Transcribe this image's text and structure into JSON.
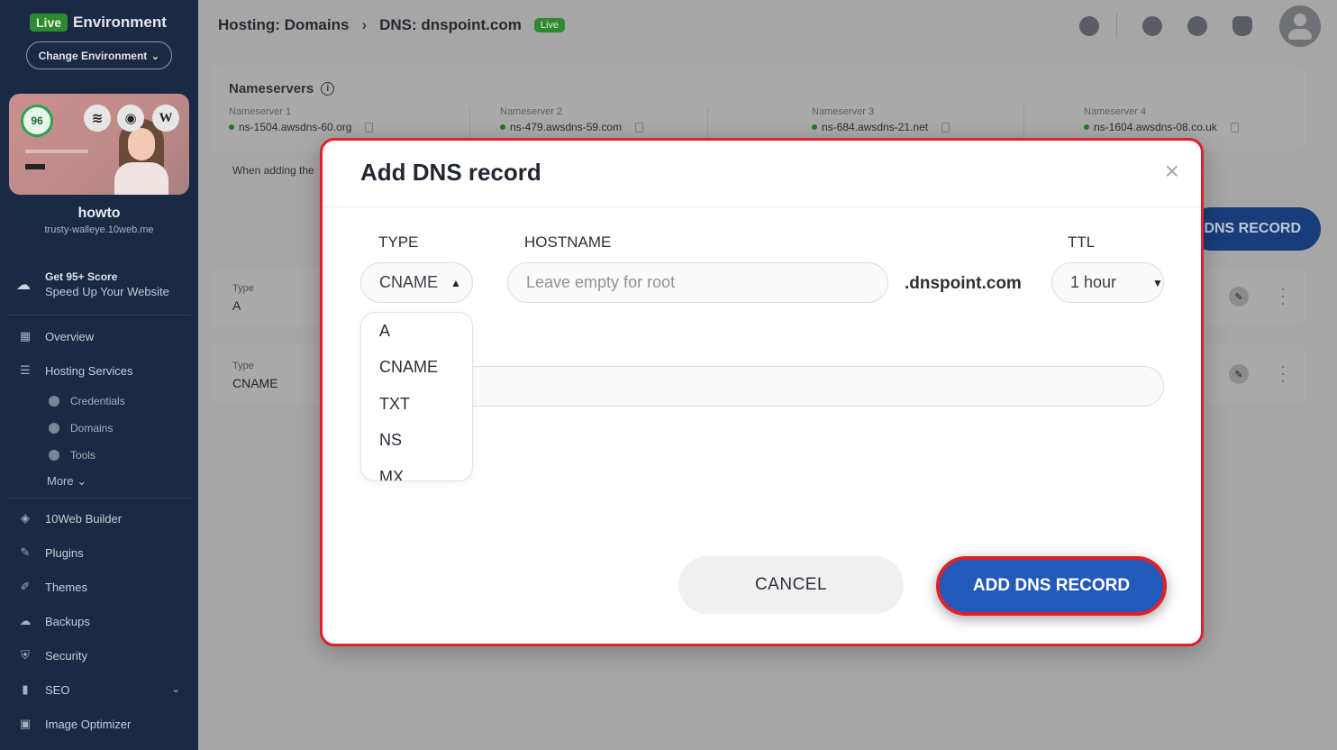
{
  "sidebar": {
    "env_badge": "Live",
    "env_title": "Environment",
    "change_env": "Change Environment",
    "score": "96",
    "card_icons": [
      "layers-icon",
      "eye-icon",
      "wordpress-icon"
    ],
    "wp_letter": "W",
    "site_name": "howto",
    "site_url": "trusty-walleye.10web.me",
    "promo_line1": "Get 95+ Score",
    "promo_line2": "Speed Up Your Website",
    "nav": {
      "overview": "Overview",
      "hosting_services": "Hosting Services",
      "credentials": "Credentials",
      "domains": "Domains",
      "tools": "Tools",
      "more": "More",
      "builder": "10Web Builder",
      "plugins": "Plugins",
      "themes": "Themes",
      "backups": "Backups",
      "security": "Security",
      "seo": "SEO",
      "image_optimizer": "Image Optimizer"
    }
  },
  "header": {
    "crumb1": "Hosting: Domains",
    "crumb2": "DNS: dnspoint.com",
    "badge": "Live"
  },
  "nameservers": {
    "title": "Nameservers",
    "items": [
      {
        "label": "Nameserver 1",
        "value": "ns-1504.awsdns-60.org"
      },
      {
        "label": "Nameserver 2",
        "value": "ns-479.awsdns-59.com"
      },
      {
        "label": "Nameserver 3",
        "value": "ns-684.awsdns-21.net"
      },
      {
        "label": "Nameserver 4",
        "value": "ns-1604.awsdns-08.co.uk"
      }
    ],
    "hint": "When adding the"
  },
  "background": {
    "add_button": "DNS RECORD",
    "records": [
      {
        "type_label": "Type",
        "type_value": "A"
      },
      {
        "type_label": "Type",
        "type_value": "CNAME"
      }
    ]
  },
  "modal": {
    "title": "Add DNS record",
    "type_label": "TYPE",
    "hostname_label": "HOSTNAME",
    "ttl_label": "TTL",
    "type_value": "CNAME",
    "hostname_placeholder": "Leave empty for root",
    "domain_suffix": ".dnspoint.com",
    "ttl_value": "1 hour",
    "type_options": [
      "A",
      "CNAME",
      "TXT",
      "NS",
      "MX"
    ],
    "cancel": "CANCEL",
    "submit": "ADD DNS RECORD"
  },
  "colors": {
    "sidebar_bg": "#1b2a44",
    "accent_blue": "#2359b8",
    "highlight_red": "#e0202a",
    "live_green": "#2e8a2f"
  }
}
